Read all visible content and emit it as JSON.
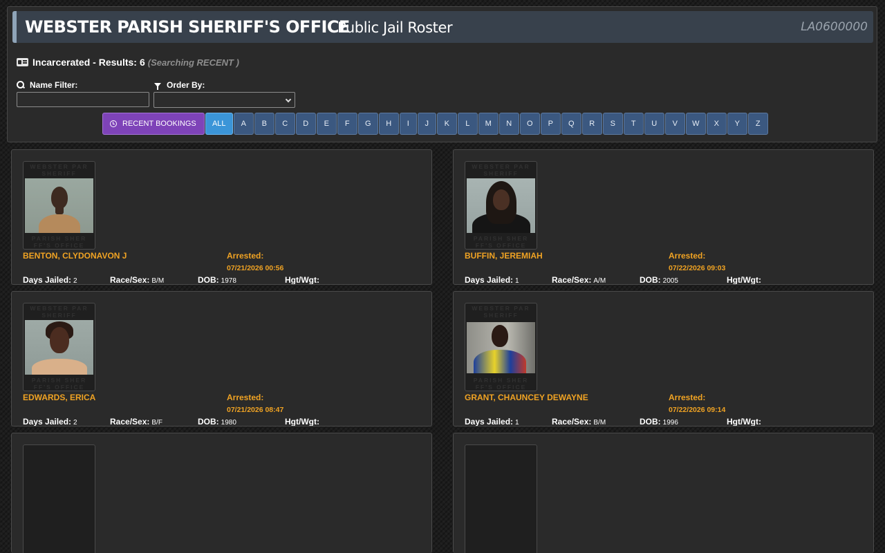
{
  "header": {
    "agency": "WEBSTER PARISH SHERIFF'S OFFICE",
    "subtitle": "Public Jail Roster",
    "code": "LA0600000"
  },
  "results": {
    "status": "Incarcerated - Results:",
    "count": "6",
    "scope": "(Searching RECENT )"
  },
  "filters": {
    "name_label": "Name Filter:",
    "name_value": "",
    "order_label": "Order By:",
    "order_value": ""
  },
  "nav": {
    "recent_label": "RECENT BOOKINGS",
    "all_label": "ALL",
    "letters": [
      "A",
      "B",
      "C",
      "D",
      "E",
      "F",
      "G",
      "H",
      "I",
      "J",
      "K",
      "L",
      "M",
      "N",
      "O",
      "P",
      "Q",
      "R",
      "S",
      "T",
      "U",
      "V",
      "W",
      "X",
      "Y",
      "Z"
    ]
  },
  "labels": {
    "arrested": "Arrested:",
    "days_jailed": "Days Jailed:",
    "race_sex": "Race/Sex:",
    "dob": "DOB:",
    "hgt_wgt": "Hgt/Wgt:",
    "watermark_lines": [
      "WEBSTER PAR",
      "SHERIFF",
      "PARISH SHER",
      "FF'S OFFICE"
    ]
  },
  "inmates": [
    {
      "name": "BENTON, CLYDONAVON J",
      "arrested": "07/21/2026 00:56",
      "days_jailed": "2",
      "race_sex": "B/M",
      "dob": "1978",
      "hgt_wgt": ""
    },
    {
      "name": "BUFFIN, JEREMIAH",
      "arrested": "07/22/2026 09:03",
      "days_jailed": "1",
      "race_sex": "A/M",
      "dob": "2005",
      "hgt_wgt": ""
    },
    {
      "name": "EDWARDS, ERICA",
      "arrested": "07/21/2026 08:47",
      "days_jailed": "2",
      "race_sex": "B/F",
      "dob": "1980",
      "hgt_wgt": ""
    },
    {
      "name": "GRANT, CHAUNCEY DEWAYNE",
      "arrested": "07/22/2026 09:14",
      "days_jailed": "1",
      "race_sex": "B/M",
      "dob": "1996",
      "hgt_wgt": ""
    }
  ]
}
